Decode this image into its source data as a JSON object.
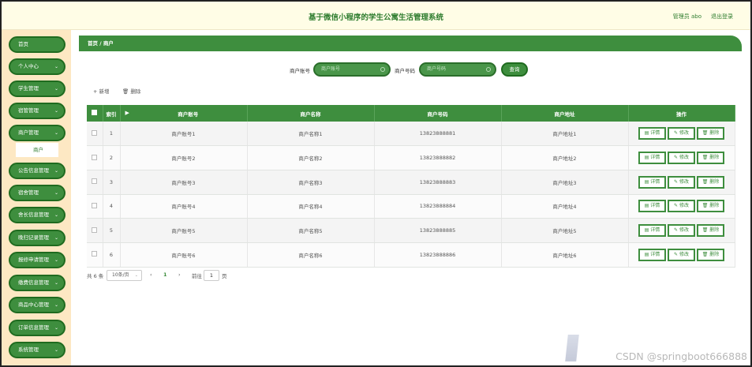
{
  "header": {
    "title": "基于微信小程序的学生公寓生活管理系统",
    "admin": "管理员 abo",
    "logout": "退出登录"
  },
  "sidebar": {
    "items": [
      {
        "label": "首页",
        "chevron": false
      },
      {
        "label": "个人中心",
        "chevron": true
      },
      {
        "label": "学生管理",
        "chevron": true
      },
      {
        "label": "宿管管理",
        "chevron": true
      },
      {
        "label": "商户管理",
        "chevron": true
      },
      {
        "label": "公告信息管理",
        "chevron": true
      },
      {
        "label": "宿舍管理",
        "chevron": true
      },
      {
        "label": "舍长信息管理",
        "chevron": true
      },
      {
        "label": "晚归记录管理",
        "chevron": true
      },
      {
        "label": "报修申请管理",
        "chevron": true
      },
      {
        "label": "缴费信息管理",
        "chevron": true
      },
      {
        "label": "商品中心管理",
        "chevron": true
      },
      {
        "label": "订单信息管理",
        "chevron": true
      },
      {
        "label": "系统管理",
        "chevron": true
      }
    ],
    "submenu": "商户",
    "chevron_icon": "chevron-down-icon"
  },
  "breadcrumb": "首页 / 商户",
  "search": {
    "account_label": "商户账号",
    "account_placeholder": "商户账号",
    "phone_label": "商户号码",
    "phone_placeholder": "商户号码",
    "query_button": "查询"
  },
  "toolbar": {
    "add": "+ 新增",
    "delete": "🗑 删除"
  },
  "table": {
    "headers": [
      "索引",
      "商户账号",
      "商户名称",
      "商户号码",
      "商户地址",
      "操作"
    ],
    "rows": [
      {
        "index": "1",
        "account": "商户账号1",
        "name": "商户名称1",
        "phone": "13823888881",
        "address": "商户地址1"
      },
      {
        "index": "2",
        "account": "商户账号2",
        "name": "商户名称2",
        "phone": "13823888882",
        "address": "商户地址2"
      },
      {
        "index": "3",
        "account": "商户账号3",
        "name": "商户名称3",
        "phone": "13823888883",
        "address": "商户地址3"
      },
      {
        "index": "4",
        "account": "商户账号4",
        "name": "商户名称4",
        "phone": "13823888884",
        "address": "商户地址4"
      },
      {
        "index": "5",
        "account": "商户账号5",
        "name": "商户名称5",
        "phone": "13823888885",
        "address": "商户地址5"
      },
      {
        "index": "6",
        "account": "商户账号6",
        "name": "商户名称6",
        "phone": "13823888886",
        "address": "商户地址6"
      }
    ],
    "actions": {
      "detail": "▤ 详情",
      "edit": "✎ 修改",
      "delete": "🗑 删除"
    }
  },
  "pagination": {
    "total": "共 6 条",
    "page_size": "10条/页",
    "prev": "‹",
    "current": "1",
    "next": "›",
    "goto_label": "前往",
    "goto_value": "1",
    "page_suffix": "页"
  },
  "watermark": "CSDN @springboot666888",
  "colors": {
    "primary": "#3e8e3e",
    "sidebar_bg": "#fde8c3",
    "header_bg": "#fffde6"
  }
}
